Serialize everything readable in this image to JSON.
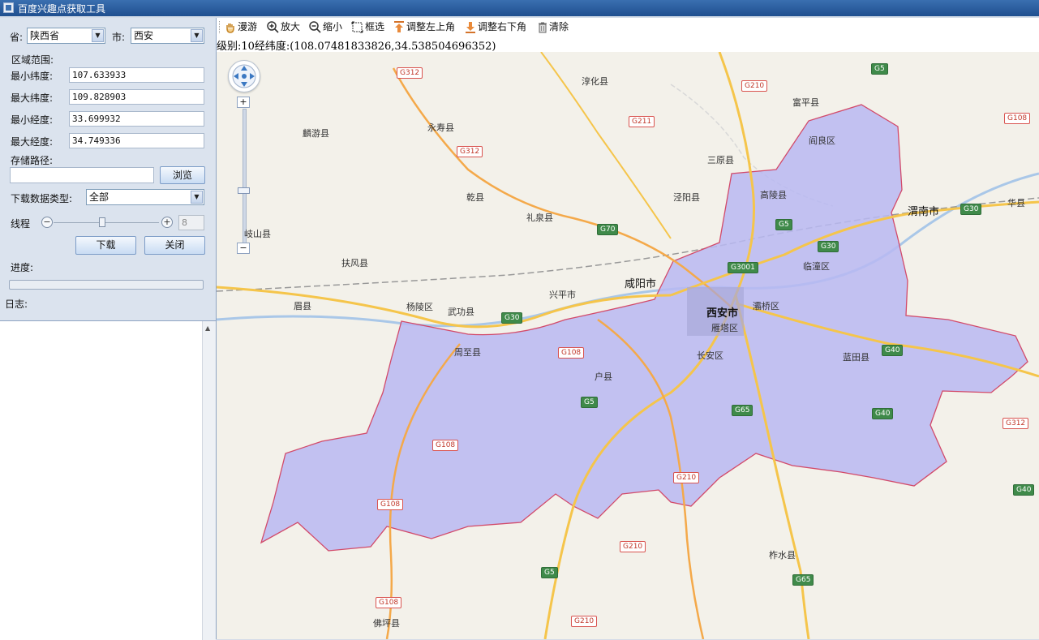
{
  "window": {
    "title": "百度兴趣点获取工具"
  },
  "form": {
    "province_label": "省:",
    "province_value": "陕西省",
    "city_label": "市:",
    "city_value": "西安",
    "region_label": "区域范围:",
    "min_lat_label": "最小纬度:",
    "min_lat_value": "107.633933",
    "max_lat_label": "最大纬度:",
    "max_lat_value": "109.828903",
    "min_lng_label": "最小经度:",
    "min_lng_value": "33.699932",
    "max_lng_label": "最大经度:",
    "max_lng_value": "34.749336",
    "storage_label": "存储路径:",
    "storage_value": "",
    "browse_label": "浏览",
    "type_label": "下载数据类型:",
    "type_value": "全部",
    "thread_label": "线程",
    "thread_value": "8",
    "thread_minus": "−",
    "thread_plus": "+",
    "download_label": "下载",
    "close_label": "关闭",
    "progress_label": "进度:",
    "progress_fraction": 0,
    "log_label": "日志:"
  },
  "toolbar": {
    "pan": "漫游",
    "zoom_in": "放大",
    "zoom_out": "缩小",
    "box_select": "框选",
    "adjust_top_left": "调整左上角",
    "adjust_bottom_right": "调整右下角",
    "clear": "清除"
  },
  "status": {
    "text": "级别:10经纬度:(108.07481833826,34.538504696352)"
  },
  "map": {
    "zoom_plus": "+",
    "zoom_minus": "−",
    "city_labels": {
      "chunhua": "淳化县",
      "fuping": "富平县",
      "linyou": "麟游县",
      "yongshou": "永寿县",
      "yanliang": "阎良区",
      "sanyuan": "三原县",
      "gaoling": "高陵县",
      "qianxian": "乾县",
      "jingyang": "泾阳县",
      "liquan": "礼泉县",
      "weinan": "渭南市",
      "huaxian": "华县",
      "qishan": "岐山县",
      "fufeng": "扶风县",
      "xianyang": "咸阳市",
      "lintong": "临潼区",
      "xingping": "兴平市",
      "meixian": "眉县",
      "yangling": "杨陵区",
      "wugong": "武功县",
      "xian": "西安市",
      "baqiao": "灞桥区",
      "yanta": "雁塔区",
      "zhouzhi": "周至县",
      "changan": "长安区",
      "lantian": "蓝田县",
      "huxian": "户县",
      "zhashui": "柞水县",
      "foping": "佛坪县"
    },
    "shields": {
      "g312a": "G312",
      "g210a": "G210",
      "g5a": "G5",
      "g108a": "G108",
      "g211": "G211",
      "g312b": "G312",
      "g70": "G70",
      "g5b": "G5",
      "g30a": "G30",
      "g30b": "G30",
      "g3001": "G3001",
      "g30c": "G30",
      "g108b": "G108",
      "g40a": "G40",
      "g5c": "G5",
      "g65a": "G65",
      "g108c": "G108",
      "g210b": "G210",
      "g40b": "G40",
      "g312c": "G312",
      "g108d": "G108",
      "g40c": "G40",
      "g210c": "G210",
      "g5d": "G5",
      "g65b": "G65",
      "g108e": "G108",
      "g210d": "G210"
    },
    "colors": {
      "selection_fill": "#b9b9f2",
      "selection_stroke": "#d24a6a",
      "highway": "#f5c54b",
      "national_road": "#f4a94a"
    }
  }
}
